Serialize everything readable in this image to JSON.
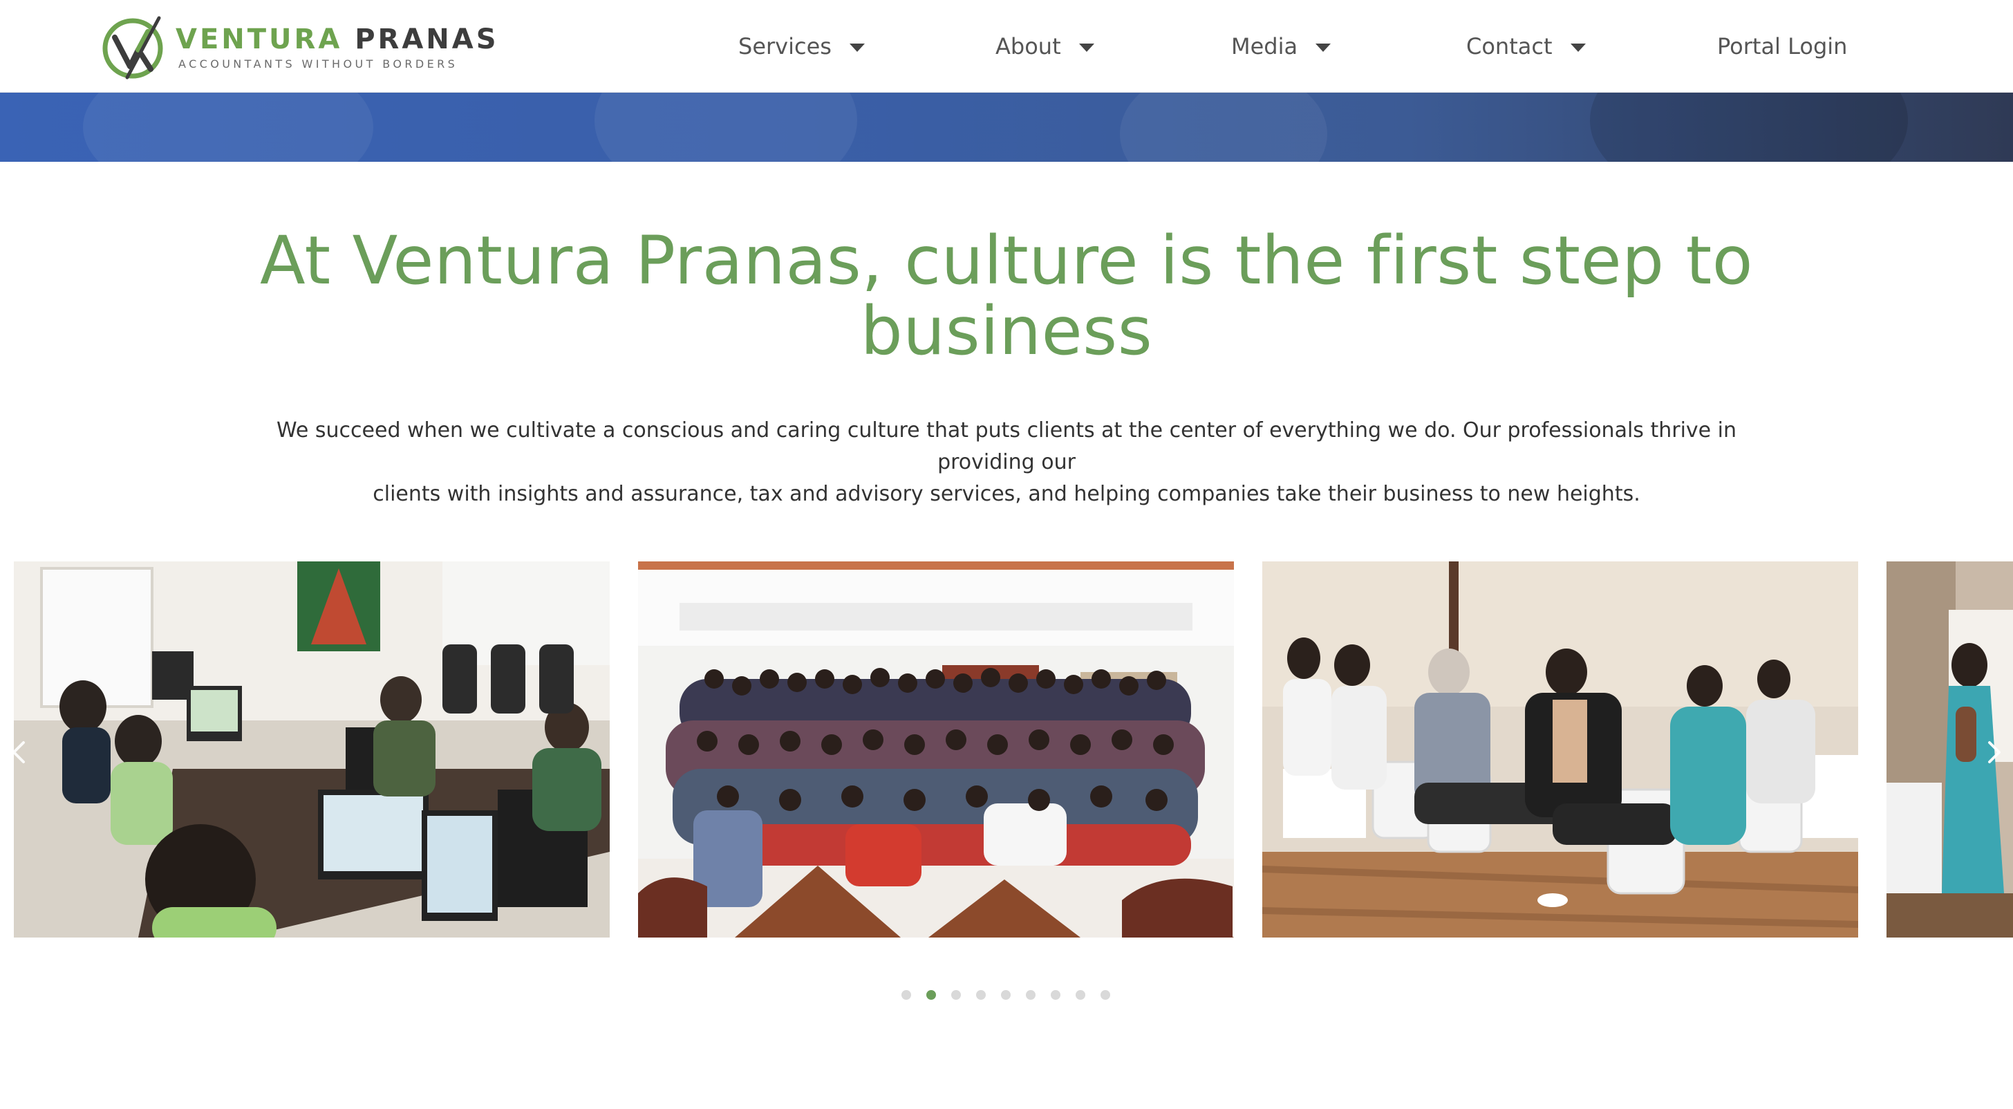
{
  "brand": {
    "name_part1": "VENTURA",
    "name_part2": "PRANAS",
    "tagline": "ACCOUNTANTS WITHOUT BORDERS",
    "logo_icon": "vp-logo-icon"
  },
  "nav": {
    "items": [
      {
        "label": "Services",
        "has_dropdown": true
      },
      {
        "label": "About",
        "has_dropdown": true
      },
      {
        "label": "Media",
        "has_dropdown": true
      },
      {
        "label": "Contact",
        "has_dropdown": true
      },
      {
        "label": "Portal Login",
        "has_dropdown": false
      }
    ]
  },
  "content": {
    "headline_line1": "At Ventura Pranas, culture is the first step to",
    "headline_line2": "business",
    "intro_line1": "We succeed when we cultivate a conscious and caring culture that puts clients at the center of everything we do. Our professionals thrive in providing our",
    "intro_line2": "clients with insights and assurance, tax and advisory services, and helping companies take their business to new heights."
  },
  "carousel": {
    "slides": [
      {
        "subject": "office-workstations-photo"
      },
      {
        "subject": "team-group-photo"
      },
      {
        "subject": "audience-seated-photo"
      },
      {
        "subject": "speaker-photo"
      }
    ],
    "prev_icon": "chevron-left-icon",
    "next_icon": "chevron-right-icon",
    "dot_count": 9,
    "active_dot_index": 1
  },
  "colors": {
    "brand_green": "#6b9e5a",
    "nav_text": "#555555",
    "hero_blue": "#3a63b5",
    "body_text": "#333333",
    "dot_inactive": "#d9d9d9"
  }
}
